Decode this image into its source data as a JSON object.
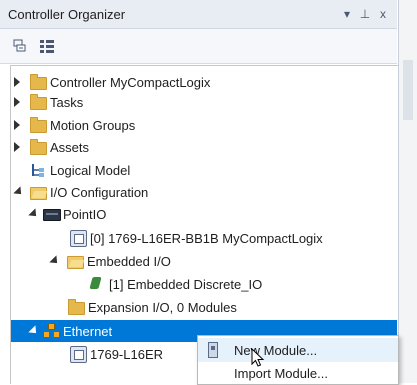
{
  "panel": {
    "title": "Controller Organizer",
    "dropdown_icon": "▾",
    "pin_icon": "⊥",
    "close_icon": "x"
  },
  "tree": {
    "items": [
      {
        "label": "Controller MyCompactLogix",
        "expander": "collapsed",
        "icon": "folder-icon"
      },
      {
        "label": "Tasks",
        "expander": "collapsed",
        "icon": "folder-icon"
      },
      {
        "label": "Motion Groups",
        "expander": "collapsed",
        "icon": "folder-icon"
      },
      {
        "label": "Assets",
        "expander": "collapsed",
        "icon": "folder-icon"
      },
      {
        "label": "Logical Model",
        "expander": "none",
        "icon": "logical-model-icon"
      },
      {
        "label": "I/O Configuration",
        "expander": "expanded",
        "icon": "open-folder-icon"
      },
      {
        "label": "PointIO",
        "expander": "expanded",
        "icon": "rack-icon"
      },
      {
        "label": "[0] 1769-L16ER-BB1B MyCompactLogix",
        "expander": "none",
        "icon": "module-icon"
      },
      {
        "label": "Embedded I/O",
        "expander": "expanded",
        "icon": "open-folder-icon"
      },
      {
        "label": "[1] Embedded Discrete_IO",
        "expander": "none",
        "icon": "io-module-icon"
      },
      {
        "label": "Expansion I/O, 0 Modules",
        "expander": "none",
        "icon": "folder-icon"
      },
      {
        "label": "Ethernet",
        "expander": "expanded",
        "icon": "ethernet-icon",
        "selected": true
      },
      {
        "label": "1769-L16ER",
        "expander": "none",
        "icon": "module-icon"
      }
    ]
  },
  "context_menu": {
    "items": [
      {
        "label": "New Module...",
        "hovered": true
      },
      {
        "label": "Import Module..."
      }
    ]
  },
  "colors": {
    "selection": "#0078d7",
    "title_bar": "#e8ecf3",
    "menu_hover": "#e5f1fb"
  }
}
